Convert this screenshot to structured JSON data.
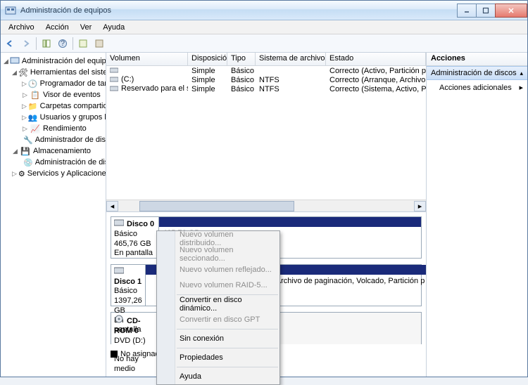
{
  "window": {
    "title": "Administración de equipos"
  },
  "menu": {
    "archivo": "Archivo",
    "accion": "Acción",
    "ver": "Ver",
    "ayuda": "Ayuda"
  },
  "tree": {
    "root": "Administración del equipo (loc",
    "herramientas": "Herramientas del sistema",
    "programador": "Programador de tareas",
    "visor": "Visor de eventos",
    "carpetas": "Carpetas compartidas",
    "usuarios": "Usuarios y grupos locale",
    "rendimiento": "Rendimiento",
    "admin_disp": "Administrador de dispo",
    "almacenamiento": "Almacenamiento",
    "admin_disc": "Administración de disc",
    "servicios": "Servicios y Aplicaciones"
  },
  "grid": {
    "headers": {
      "volumen": "Volumen",
      "disposicion": "Disposición",
      "tipo": "Tipo",
      "sistema": "Sistema de archivos",
      "estado": "Estado"
    },
    "rows": [
      {
        "vol": "",
        "dis": "Simple",
        "tipo": "Básico",
        "sis": "",
        "est": "Correcto (Activo, Partición primaria)"
      },
      {
        "vol": "(C:)",
        "dis": "Simple",
        "tipo": "Básico",
        "sis": "NTFS",
        "est": "Correcto (Arranque, Archivo de pagi"
      },
      {
        "vol": "Reservado para el sistema",
        "dis": "Simple",
        "tipo": "Básico",
        "sis": "NTFS",
        "est": "Correcto (Sistema, Activo, Partición p"
      }
    ]
  },
  "disks": {
    "d0": {
      "name": "Disco 0",
      "type": "Básico",
      "size": "465,76 GB",
      "status": "En pantalla",
      "part_size": "465,76 GB"
    },
    "d1": {
      "name": "Disco 1",
      "type": "Básico",
      "size": "1397,26 GB",
      "status": "En pantalla",
      "part_info": "Archivo de paginación, Volcado, Partición p"
    },
    "cd": {
      "name": "CD-ROM 0",
      "type": "DVD (D:)",
      "status": "No hay medio"
    }
  },
  "legend": {
    "unassigned": "No asignado"
  },
  "actions": {
    "header": "Acciones",
    "selected": "Administración de discos",
    "more": "Acciones adicionales"
  },
  "ctxmenu": {
    "nvd": "Nuevo volumen distribuido...",
    "nvs": "Nuevo volumen seccionado...",
    "nvr": "Nuevo volumen reflejado...",
    "nvraid": "Nuevo volumen RAID-5...",
    "conv_din": "Convertir en disco dinámico...",
    "conv_gpt": "Convertir en disco GPT",
    "offline": "Sin conexión",
    "props": "Propiedades",
    "help": "Ayuda"
  }
}
